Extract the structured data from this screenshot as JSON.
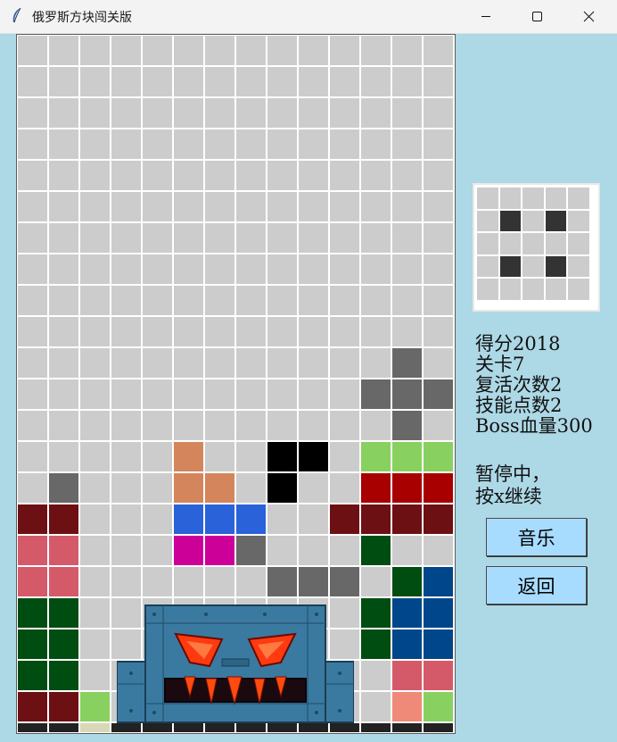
{
  "window": {
    "title": "俄罗斯方块闯关版",
    "minimize_icon": "minimize-icon",
    "maximize_icon": "maximize-icon",
    "close_icon": "close-icon",
    "app_icon": "feather-icon"
  },
  "board": {
    "cols": 14,
    "rows": 22,
    "empty_color": "#cccccc",
    "grid_line_color": "#ffffff",
    "rows_data": [
      "..............",
      "..............",
      "..............",
      "..............",
      "..............",
      "..............",
      "..............",
      "..............",
      "..............",
      "..............",
      "............G.",
      "...........GGG",
      "............G.",
      ".....O..KK.LLLL",
      ".G...OO.K..RRRR",
      "DD...BBB..DDDDD",
      "PP...MMG...F...",
      "PP......GGG.FNNN",
      "FF.........FNNN",
      "FF.........FNNN",
      "FF..........PP",
      "DDL.........SLY"
    ],
    "bottom_strip": [
      "#222222",
      "#222222",
      "#d8d8b8",
      "#222222",
      "#222222",
      "#222222",
      "#222222",
      "#222222",
      "#222222",
      "#222222",
      "#222222",
      "#222222",
      "#222222",
      "#222222"
    ],
    "palette": {
      "G": "#686868",
      "O": "#d4855c",
      "K": "#000000",
      "L": "#88d160",
      "R": "#a80000",
      "D": "#6d1014",
      "B": "#2962d9",
      "P": "#d45a6a",
      "M": "#cc0099",
      "F": "#004d12",
      "N": "#00468a",
      "S": "#f08a78",
      "Y": "#e8e030"
    }
  },
  "boss": {
    "name": "boss-monster",
    "colors": {
      "body": "#3a7aa0",
      "eyes": "#ff3a10",
      "teeth": "#ff5010"
    }
  },
  "preview": {
    "cols": 5,
    "rows": 5,
    "filled": [
      [
        1,
        1
      ],
      [
        1,
        3
      ],
      [
        3,
        1
      ],
      [
        3,
        3
      ]
    ],
    "filled_color": "#333333",
    "empty_color": "#cccccc"
  },
  "stats": {
    "score": "得分2018",
    "level": "关卡7",
    "revives": "复活次数2",
    "skill_points": "技能点数2",
    "boss_hp": "Boss血量300"
  },
  "status": {
    "line1": "暂停中，",
    "line2": "按x继续"
  },
  "buttons": {
    "music": "音乐",
    "back": "返回"
  }
}
